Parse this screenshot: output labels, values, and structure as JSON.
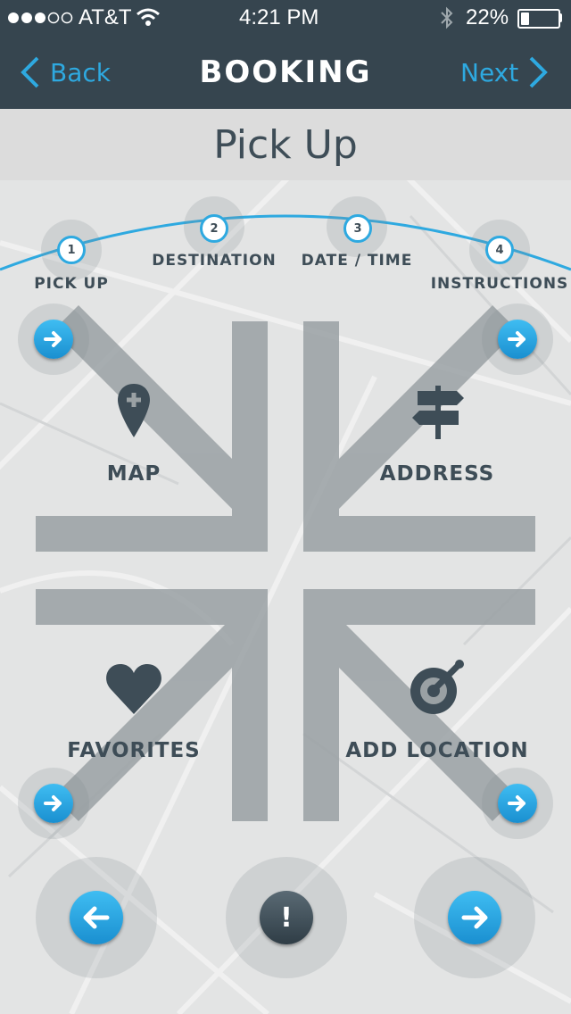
{
  "status_bar": {
    "carrier": "AT&T",
    "time": "4:21 PM",
    "battery": "22%",
    "battery_level": 0.22
  },
  "nav": {
    "back_label": "Back",
    "title": "BOOKING",
    "next_label": "Next"
  },
  "page": {
    "title": "Pick Up"
  },
  "steps": [
    {
      "number": "1",
      "label": "PICK UP"
    },
    {
      "number": "2",
      "label": "DESTINATION"
    },
    {
      "number": "3",
      "label": "DATE / TIME"
    },
    {
      "number": "4",
      "label": "INSTRUCTIONS"
    }
  ],
  "options": {
    "map": "MAP",
    "address": "ADDRESS",
    "favorites": "FAVORITES",
    "add_location": "ADD LOCATION"
  },
  "bottom": {
    "info_symbol": "!"
  },
  "colors": {
    "nav_bg": "#36454f",
    "accent": "#2ea9e0",
    "text_dark": "#3e4d57",
    "arrow_gray": "#9aa1a4"
  },
  "icons": [
    "map-pin-icon",
    "signpost-icon",
    "heart-icon",
    "target-pin-icon",
    "arrow-right-icon",
    "arrow-left-icon",
    "alert-icon"
  ]
}
